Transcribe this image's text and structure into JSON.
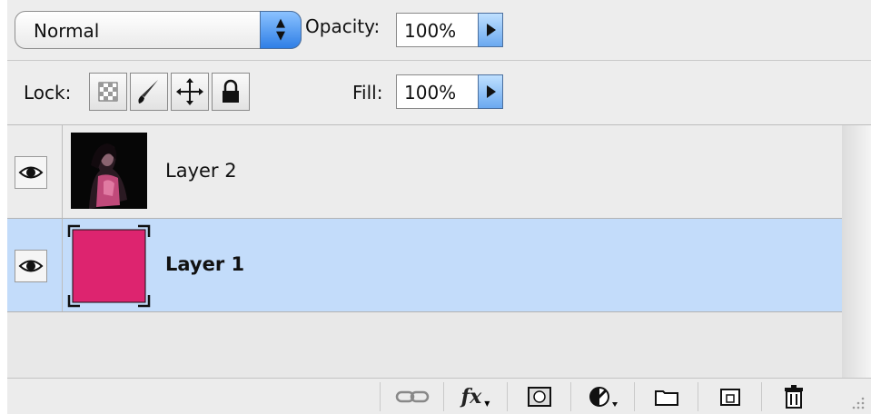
{
  "header": {
    "blend_mode": "Normal",
    "opacity_label": "Opacity:",
    "opacity_value": "100%",
    "fill_label": "Fill:",
    "fill_value": "100%",
    "lock_label": "Lock:"
  },
  "lock_buttons": [
    {
      "icon": "lock-transparent-pixels-icon"
    },
    {
      "icon": "lock-image-pixels-icon"
    },
    {
      "icon": "lock-position-icon"
    },
    {
      "icon": "lock-all-icon"
    }
  ],
  "layers": [
    {
      "name": "Layer 2",
      "visible": true,
      "selected": false,
      "thumbnail": "photo"
    },
    {
      "name": "Layer 1",
      "visible": true,
      "selected": true,
      "thumbnail": "solid-color",
      "color": "#dd246f"
    }
  ],
  "toolbar": [
    {
      "icon": "link-layers-icon"
    },
    {
      "icon": "fx-icon",
      "label": "fx"
    },
    {
      "icon": "layer-mask-icon"
    },
    {
      "icon": "adjustment-layer-icon"
    },
    {
      "icon": "new-group-icon"
    },
    {
      "icon": "new-layer-icon"
    },
    {
      "icon": "trash-icon"
    }
  ],
  "colors": {
    "selected_row": "#c3dcfa",
    "accent_blue": "#2f7fe6",
    "layer1_fill": "#dd246f"
  }
}
